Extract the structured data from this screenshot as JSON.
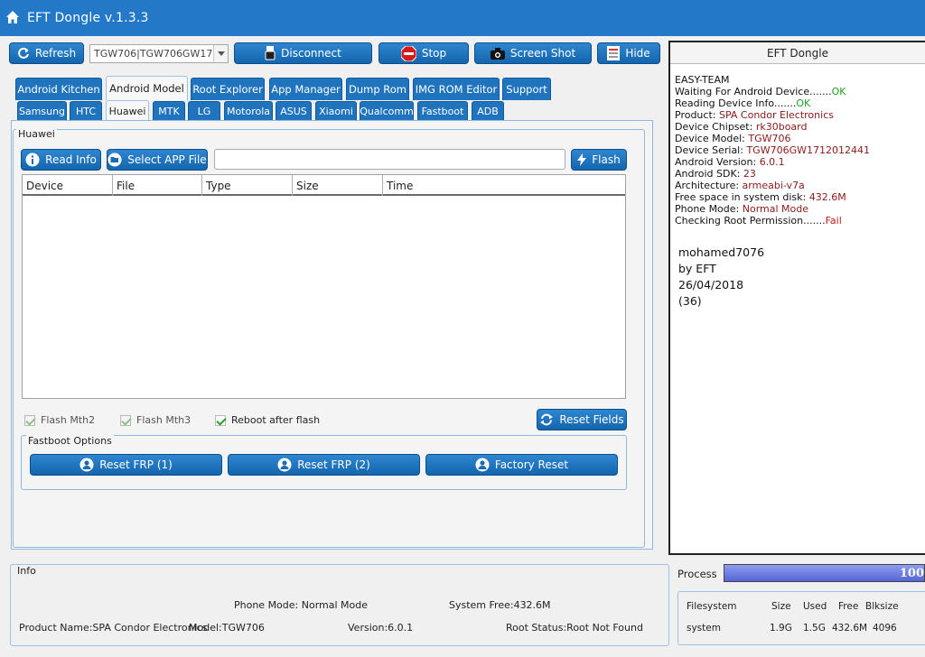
{
  "app": {
    "title": "EFT Dongle  v.1.3.3"
  },
  "toolbar": {
    "refresh": "Refresh",
    "device_value": "TGW706|TGW706GW17",
    "disconnect": "Disconnect",
    "stop": "Stop",
    "screenshot": "Screen Shot",
    "hide": "Hide"
  },
  "main_tabs": [
    "Android Kitchen",
    "Android Model",
    "Root Explorer",
    "App Manager",
    "Dump Rom",
    "IMG ROM Editor",
    "Support"
  ],
  "sub_tabs": [
    "Samsung",
    "HTC",
    "Huawei",
    "MTK",
    "LG",
    "Motorola",
    "ASUS",
    "Xiaomi",
    "Qualcomm",
    "Fastboot",
    "ADB"
  ],
  "huawei": {
    "group": "Huawei",
    "read_info": "Read Info",
    "select_app": "Select APP File",
    "file_path": "",
    "flash": "Flash",
    "columns": [
      "Device",
      "File",
      "Type",
      "Size",
      "Time"
    ],
    "flash_mth2": "Flash Mth2",
    "flash_mth3": "Flash Mth3",
    "reboot_after_flash": "Reboot after flash",
    "reset_fields": "Reset Fields",
    "fastboot_group": "Fastboot Options",
    "reset_frp1": "Reset FRP (1)",
    "reset_frp2": "Reset FRP (2)",
    "factory_reset": "Factory Reset"
  },
  "log": {
    "header": "EFT Dongle",
    "lines": [
      {
        "label": "EASY-TEAM",
        "value": ""
      },
      {
        "label": "Waiting For Android Device.......",
        "value": "OK"
      },
      {
        "label": "Reading Device Info.......",
        "value": "OK"
      },
      {
        "label": "Product: ",
        "value": "SPA Condor Electronics"
      },
      {
        "label": "Device Chipset: ",
        "value": "rk30board"
      },
      {
        "label": "Device Model: ",
        "value": "TGW706"
      },
      {
        "label": "Device Serial: ",
        "value": "TGW706GW1712012441"
      },
      {
        "label": "Android Version: ",
        "value": "6.0.1"
      },
      {
        "label": "Android SDK: ",
        "value": "23"
      },
      {
        "label": "Architecture: ",
        "value": "armeabi-v7a"
      },
      {
        "label": "Free space in system disk: ",
        "value": "432.6M"
      },
      {
        "label": "Phone Mode: ",
        "value": "Normal Mode"
      },
      {
        "label": "Checking Root Permission.......",
        "value": "Fail"
      }
    ],
    "footer": [
      "mohamed7076",
      "by EFT",
      "26/04/2018",
      "(36)"
    ]
  },
  "info": {
    "group": "Info",
    "phone_mode": "Phone Mode: Normal Mode",
    "system_free": "System Free:432.6M",
    "product_name": "Product Name:SPA Condor Electronics",
    "model": "Model:TGW706",
    "version": "Version:6.0.1",
    "root_status": "Root Status:Root Not Found"
  },
  "process": {
    "label": "Process",
    "value": "100",
    "percent": 100
  },
  "filesystem": {
    "headers": [
      "Filesystem",
      "Size",
      "Used",
      "Free",
      "Blksize"
    ],
    "row": [
      "system",
      "1.9G",
      "1.5G",
      "432.6M",
      "4096"
    ]
  }
}
